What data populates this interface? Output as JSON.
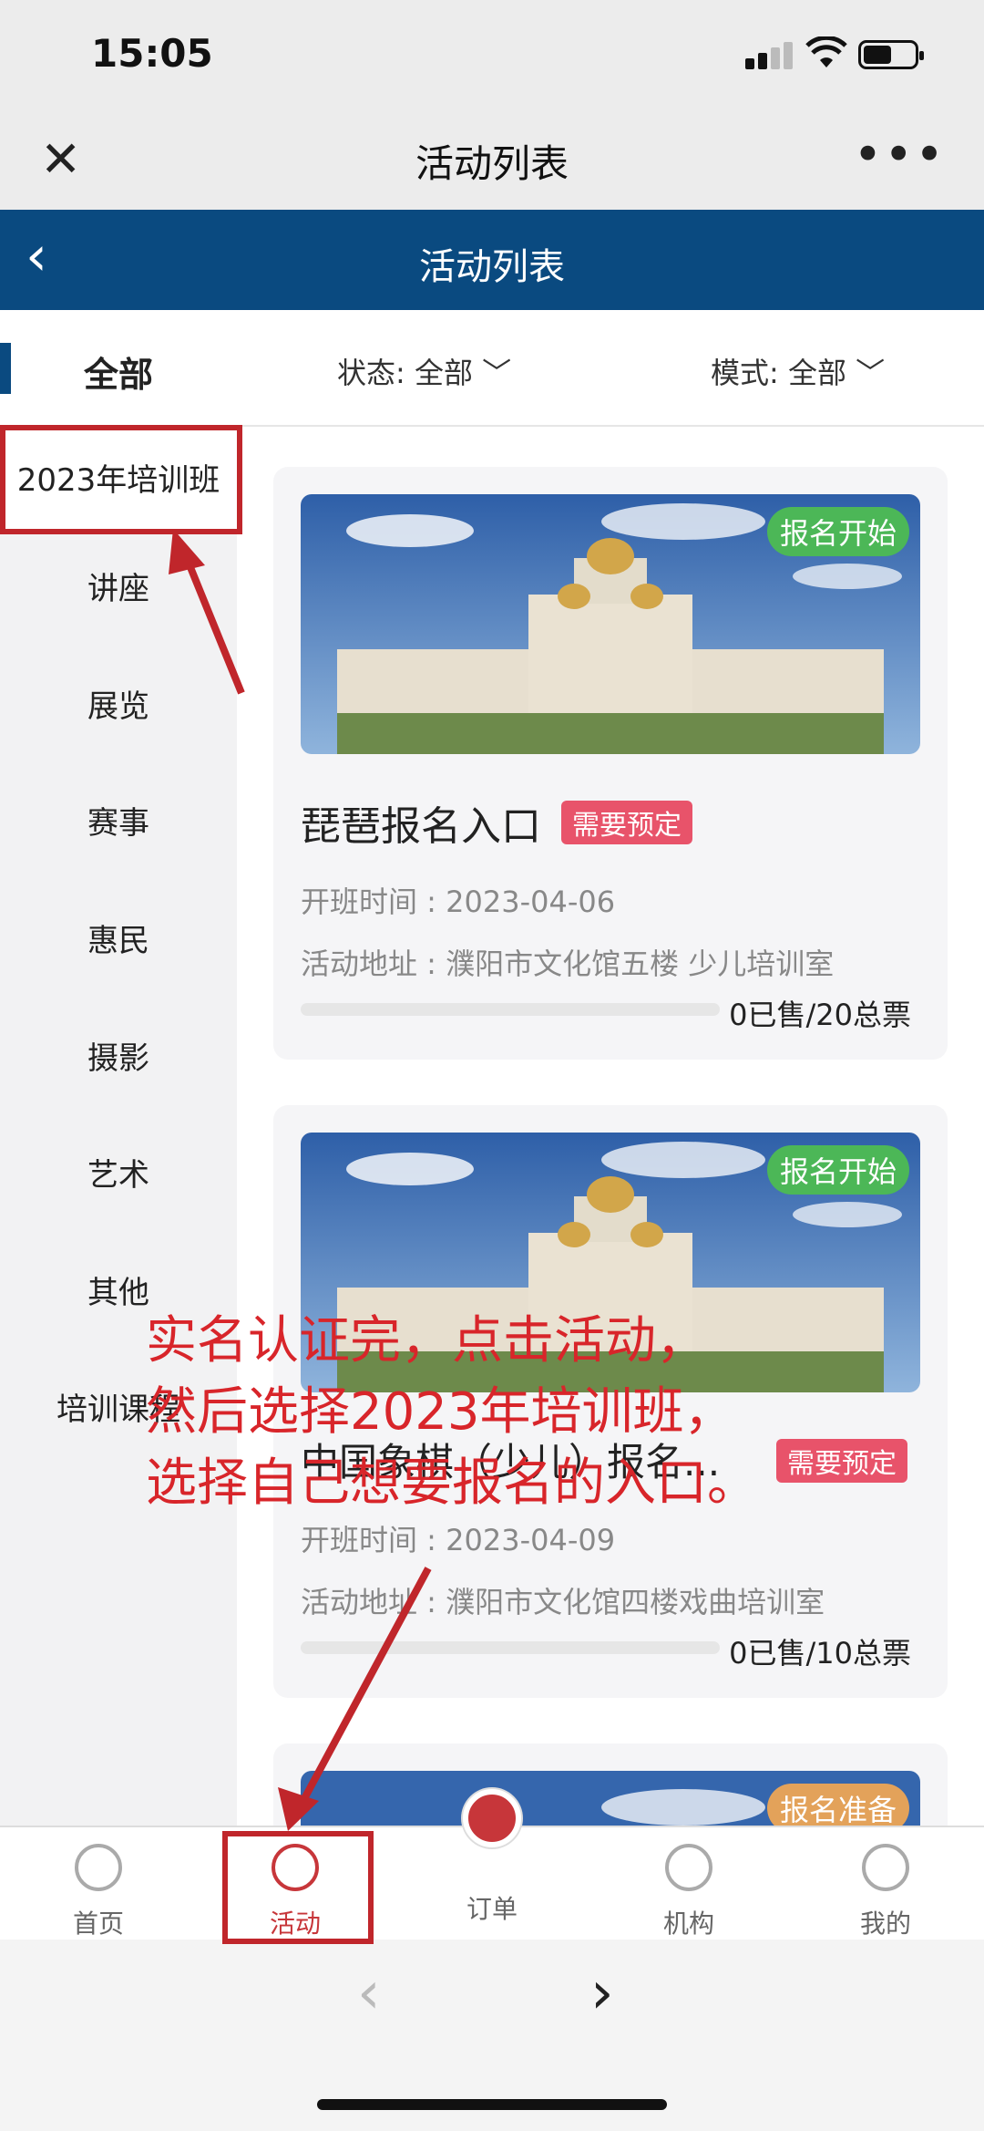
{
  "status": {
    "time": "15:05"
  },
  "wechat": {
    "title": "活动列表"
  },
  "nav": {
    "title": "活动列表"
  },
  "filters": {
    "all": "全部",
    "status": "状态: 全部 ﹀",
    "mode": "模式: 全部 ﹀"
  },
  "sidebar": {
    "items": [
      {
        "label": "2023年培训班"
      },
      {
        "label": "讲座"
      },
      {
        "label": "展览"
      },
      {
        "label": "赛事"
      },
      {
        "label": "惠民"
      },
      {
        "label": "摄影"
      },
      {
        "label": "艺术"
      },
      {
        "label": "其他"
      },
      {
        "label": "培训课程"
      }
    ]
  },
  "cards": [
    {
      "badge": "报名开始",
      "badge_color": "#4cb757",
      "title": "琵琶报名入口",
      "tag": "需要预定",
      "time": "开班时间 : 2023-04-06",
      "address": "活动地址 : 濮阳市文化馆五楼 少儿培训室",
      "count": "0已售/20总票",
      "progress": 0
    },
    {
      "badge": "报名开始",
      "badge_color": "#4cb757",
      "title": "中国象棋（少儿）报名...",
      "tag": "需要预定",
      "time": "开班时间 : 2023-04-09",
      "address": "活动地址 : 濮阳市文化馆四楼戏曲培训室",
      "count": "0已售/10总票",
      "progress": 0
    },
    {
      "badge": "报名准备",
      "badge_color": "#e3a25a"
    }
  ],
  "tabs": [
    {
      "label": "首页"
    },
    {
      "label": "活动"
    },
    {
      "label": "订单"
    },
    {
      "label": "机构"
    },
    {
      "label": "我的"
    }
  ],
  "annotation": {
    "lines": [
      "实名认证完，点击活动，",
      "然后选择2023年培训班，",
      "选择自己想要报名的入口。"
    ]
  },
  "colors": {
    "nav": "#0a4a80",
    "accent": "#c7363a",
    "annotation": "#d8252a"
  }
}
